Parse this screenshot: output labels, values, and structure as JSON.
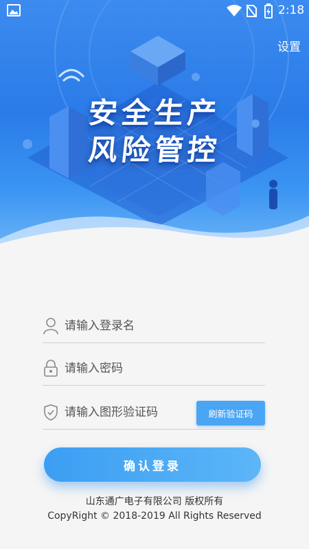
{
  "status_bar": {
    "time": "2:18"
  },
  "header": {
    "settings_label": "设置"
  },
  "hero": {
    "title_line1": "安全生产",
    "title_line2": "风险管控"
  },
  "login_form": {
    "username_placeholder": "请输入登录名",
    "password_placeholder": "请输入密码",
    "captcha_placeholder": "请输入图形验证码",
    "refresh_captcha_label": "刷新验证码",
    "submit_label": "确认登录"
  },
  "footer": {
    "company": "山东通广电子有限公司  版权所有",
    "copyright": "CopyRight ©  2018-2019  All Rights Reserved"
  },
  "colors": {
    "accent": "#3c9ef3",
    "hero_blue": "#2a7be8",
    "background": "#f5f5f5"
  },
  "icons": [
    "gallery-icon",
    "wifi-icon",
    "no-sim-icon",
    "battery-icon",
    "user-icon",
    "lock-icon",
    "shield-icon"
  ]
}
